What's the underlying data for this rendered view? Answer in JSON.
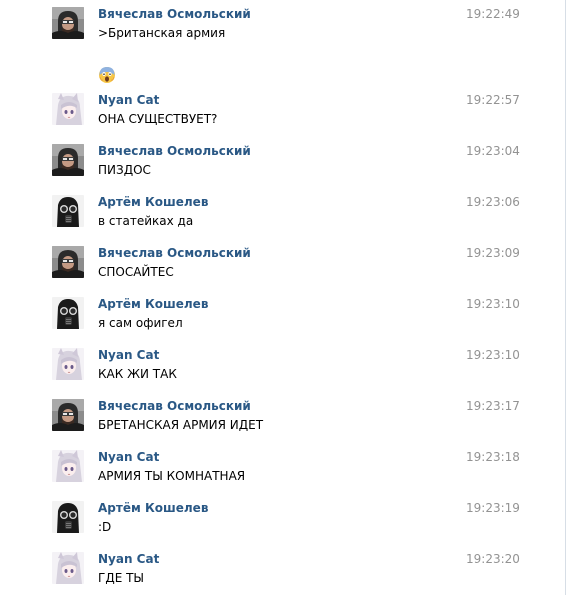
{
  "messages": [
    {
      "author": "Вячеслав Осмольский",
      "time": "19:22:49",
      "text": ">Британская армия",
      "avatar": "man-in-hood-avatar"
    },
    {
      "author": "Nyan Cat",
      "time": "19:22:57",
      "text": "ОНА СУЩЕСТВУЕТ?",
      "avatar": "anime-girl-avatar"
    },
    {
      "author": "Вячеслав Осмольский",
      "time": "19:23:04",
      "text": "ПИЗДОС",
      "avatar": "man-in-hood-avatar"
    },
    {
      "author": "Артём Кошелев",
      "time": "19:23:06",
      "text": "в статейках да",
      "avatar": "gas-mask-avatar"
    },
    {
      "author": "Вячеслав Осмольский",
      "time": "19:23:09",
      "text": "СПОСАЙТЕС",
      "avatar": "man-in-hood-avatar"
    },
    {
      "author": "Артём Кошелев",
      "time": "19:23:10",
      "text": "я сам офигел",
      "avatar": "gas-mask-avatar"
    },
    {
      "author": "Nyan Cat",
      "time": "19:23:10",
      "text": "КАК ЖИ ТАК",
      "avatar": "anime-girl-avatar"
    },
    {
      "author": "Вячеслав Осмольский",
      "time": "19:23:17",
      "text": "БРЕТАНСКАЯ АРМИЯ ИДЕТ",
      "avatar": "man-in-hood-avatar"
    },
    {
      "author": "Nyan Cat",
      "time": "19:23:18",
      "text": "АРМИЯ ТЫ КОМНАТНАЯ",
      "avatar": "anime-girl-avatar"
    },
    {
      "author": "Артём Кошелев",
      "time": "19:23:19",
      "text": ":D",
      "avatar": "gas-mask-avatar"
    },
    {
      "author": "Nyan Cat",
      "time": "19:23:20",
      "text": "ГДЕ ТЫ",
      "avatar": "anime-girl-avatar"
    }
  ],
  "first_message_extra": {
    "emoji": "screaming-face-emoji"
  },
  "colors": {
    "author": "#2a5885",
    "time": "#939393",
    "text": "#000000",
    "background": "#ffffff"
  }
}
